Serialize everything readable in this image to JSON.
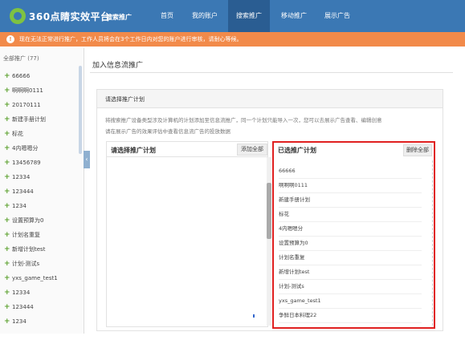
{
  "topbar": {
    "brand": "360点睛实效平台",
    "product": "搜索推广",
    "nav": [
      "首页",
      "我的账户",
      "搜索推广",
      "移动推广",
      "展示广告"
    ],
    "active_index": 2,
    "accent": "#3b78b4"
  },
  "banner": {
    "icon": "warning-icon",
    "text": "现在无法正常进行推广，工作人员将会在3个工作日内对您的账户进行审核，请耐心等候。",
    "color": "#f28a4a"
  },
  "sidebar": {
    "title": "全部推广 (77)",
    "items": [
      "66666",
      "啊啊啊0111",
      "20170111",
      "新建手册计划",
      "标花",
      "4内嗯嗯分",
      "13456789",
      "12334",
      "123444",
      "1234",
      "设置预算为0",
      "计划名重复",
      "新增计划test",
      "计划-测试s",
      "yxs_game_test1",
      "12334",
      "123444",
      "1234"
    ]
  },
  "main": {
    "page_title": "加入信息流推广",
    "panel_title": "请选择推广计划",
    "desc1": "将搜索推广设备类型涉及计算机的计划添加至信息流推广，同一个计划只能导入一次，您可以去展示广告查看、编辑创意",
    "desc2": "请在展示广告的效果评估中查看信息流广告的投放数据",
    "left_title": "请选择推广计划",
    "add_all": "添加全部",
    "right_title": "已选推广计划",
    "delete_all": "删除全部",
    "selected": [
      "66666",
      "啊啊啊0111",
      "新建手册计划",
      "标花",
      "4内嗯嗯分",
      "设置预算为0",
      "计划名重复",
      "新增计划test",
      "计划-测试s",
      "yxs_game_test1",
      "争鲜日本料理22"
    ]
  }
}
